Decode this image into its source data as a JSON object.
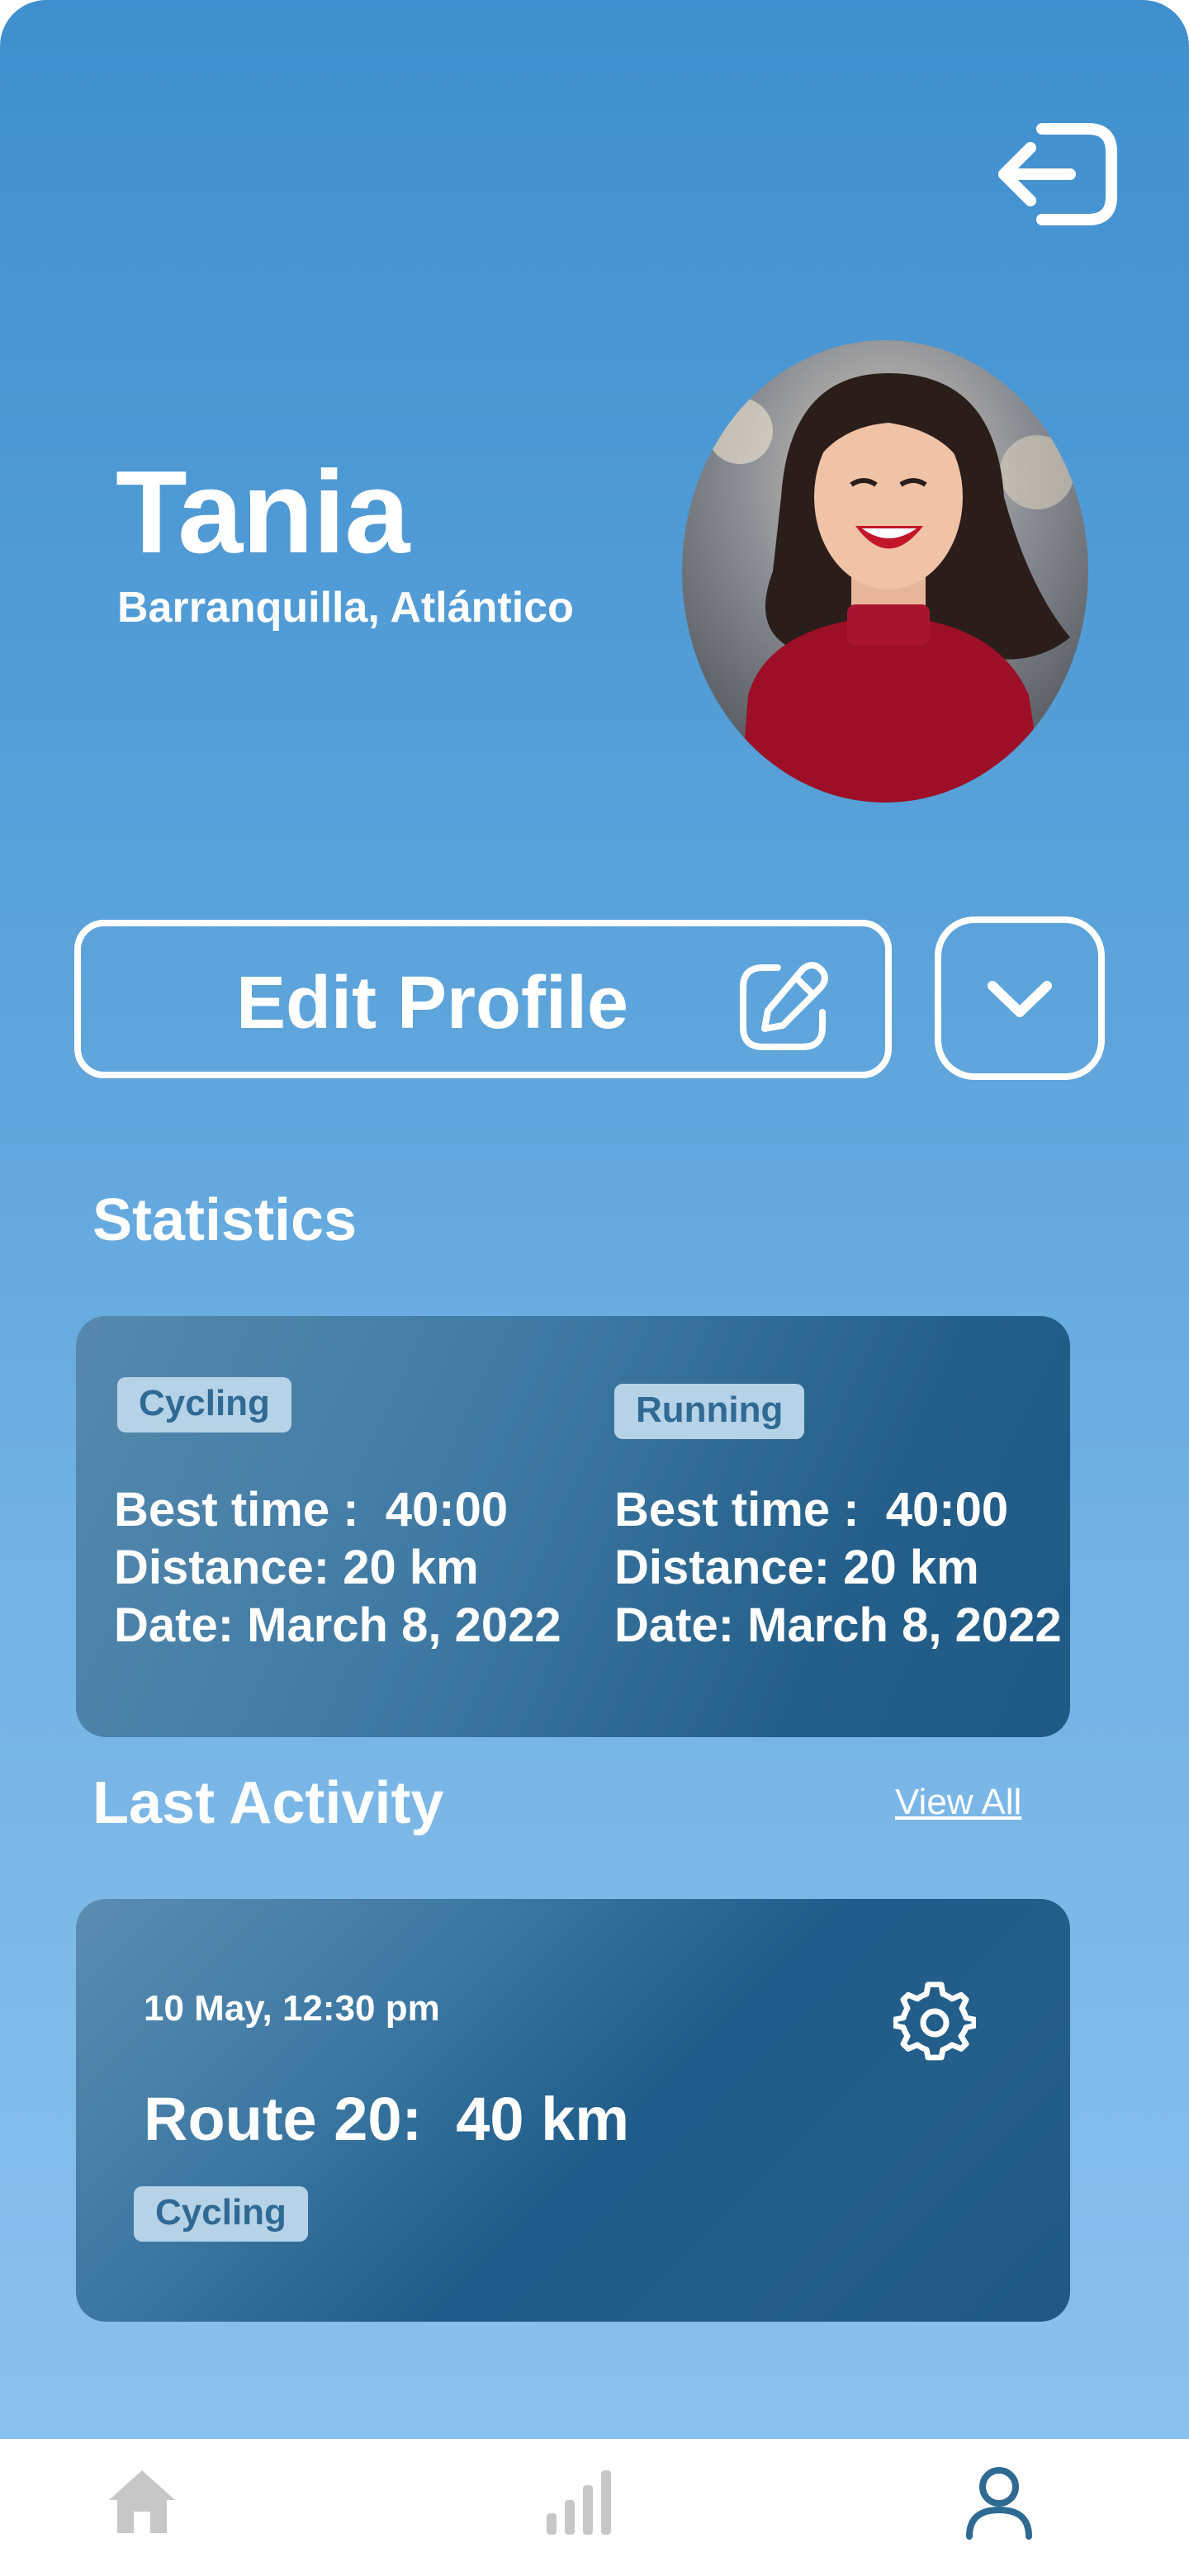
{
  "profile": {
    "name": "Tania",
    "location": "Barranquilla, Atlántico"
  },
  "header": {
    "logout_icon": "logout-icon"
  },
  "actions": {
    "edit_profile_label": "Edit Profile",
    "edit_icon": "edit-icon",
    "more_icon": "chevron-down-icon"
  },
  "statistics": {
    "title": "Statistics",
    "cards": [
      {
        "activity": "Cycling",
        "best_time": "Best time :  40:00",
        "distance": "Distance: 20 km",
        "date": "Date: March 8, 2022"
      },
      {
        "activity": "Running",
        "best_time": "Best time :  40:00",
        "distance": "Distance: 20 km",
        "date": "Date: March 8, 2022"
      }
    ]
  },
  "last_activity": {
    "title": "Last Activity",
    "view_all": "View All",
    "item": {
      "date": "10 May, 12:30 pm",
      "route": "Route 20:  40 km",
      "activity": "Cycling",
      "settings_icon": "gear-icon"
    }
  },
  "nav": {
    "items": [
      {
        "icon": "home-icon",
        "active": false
      },
      {
        "icon": "stats-icon",
        "active": false
      },
      {
        "icon": "user-icon",
        "active": true
      }
    ],
    "active_color": "#2e6a92",
    "inactive_color": "#c7c7c7"
  },
  "colors": {
    "background_top": "#3f8fce",
    "background_bottom": "#8cc2ee",
    "card": "#245f8a",
    "chip": "#b6d2e6",
    "chip_text": "#2f6a95"
  }
}
